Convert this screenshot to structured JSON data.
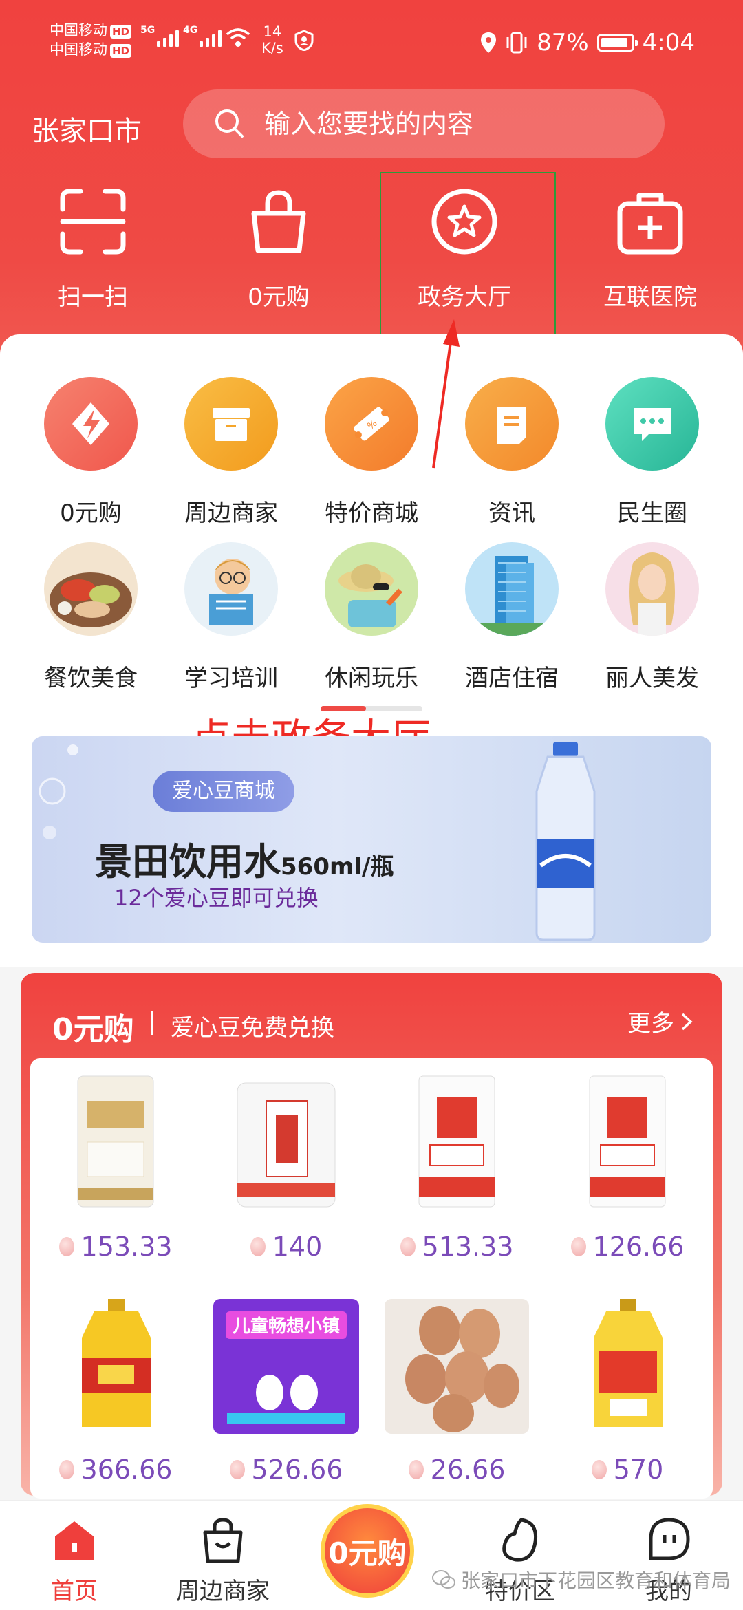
{
  "status_bar": {
    "carrier1": "中国移动",
    "carrier2": "中国移动",
    "hd": "HD",
    "net1": "5G",
    "net2": "4G",
    "speed_value": "14",
    "speed_unit": "K/s",
    "battery": "87%",
    "time": "4:04"
  },
  "header": {
    "city": "张家口市",
    "search_placeholder": "输入您要找的内容",
    "quick_nav": [
      {
        "label": "扫一扫",
        "icon": "scan-icon"
      },
      {
        "label": "0元购",
        "icon": "shopping-bag-icon"
      },
      {
        "label": "政务大厅",
        "icon": "star-badge-icon"
      },
      {
        "label": "互联医院",
        "icon": "medical-kit-icon"
      }
    ]
  },
  "categories_row1": [
    {
      "label": "0元购",
      "icon": "lightning-icon",
      "color": "#f2675a"
    },
    {
      "label": "周边商家",
      "icon": "box-icon",
      "color": "#f5a52a"
    },
    {
      "label": "特价商城",
      "icon": "ticket-icon",
      "color": "#f78b33"
    },
    {
      "label": "资讯",
      "icon": "document-icon",
      "color": "#f69a3a"
    },
    {
      "label": "民生圈",
      "icon": "chat-icon",
      "color": "#3fc9a8"
    }
  ],
  "categories_row2": [
    {
      "label": "餐饮美食",
      "icon": "food-photo"
    },
    {
      "label": "学习培训",
      "icon": "study-photo"
    },
    {
      "label": "休闲玩乐",
      "icon": "leisure-photo"
    },
    {
      "label": "酒店住宿",
      "icon": "hotel-photo"
    },
    {
      "label": "丽人美发",
      "icon": "beauty-photo"
    }
  ],
  "annotation": "点击政务大厅",
  "banner": {
    "tag": "爱心豆商城",
    "headline": "景田饮用水",
    "headline_unit": "560ml/瓶",
    "subtitle": "12个爱心豆即可兑换"
  },
  "products": {
    "title": "0元购",
    "subtitle": "爱心豆免费兑换",
    "more": "更多",
    "row1": [
      {
        "price": "153.33",
        "image": "flour-bag"
      },
      {
        "price": "140",
        "image": "flour-sack"
      },
      {
        "price": "513.33",
        "image": "wheat-flour"
      },
      {
        "price": "126.66",
        "image": "wheat-flour-2"
      }
    ],
    "row2": [
      {
        "price": "366.66",
        "image": "cooking-oil"
      },
      {
        "price": "526.66",
        "image": "kids-town",
        "banner_text": "儿童畅想小镇"
      },
      {
        "price": "26.66",
        "image": "eggs"
      },
      {
        "price": "570",
        "image": "cooking-oil-2"
      }
    ]
  },
  "tabbar": [
    {
      "label": "首页",
      "active": true
    },
    {
      "label": "周边商家"
    },
    {
      "label": "0元购"
    },
    {
      "label": "特价区"
    },
    {
      "label": "我的"
    }
  ],
  "watermark": "张家口市下花园区教育和体育局",
  "colors": {
    "primary": "#ef3f3c",
    "price": "#7b4bb8"
  }
}
